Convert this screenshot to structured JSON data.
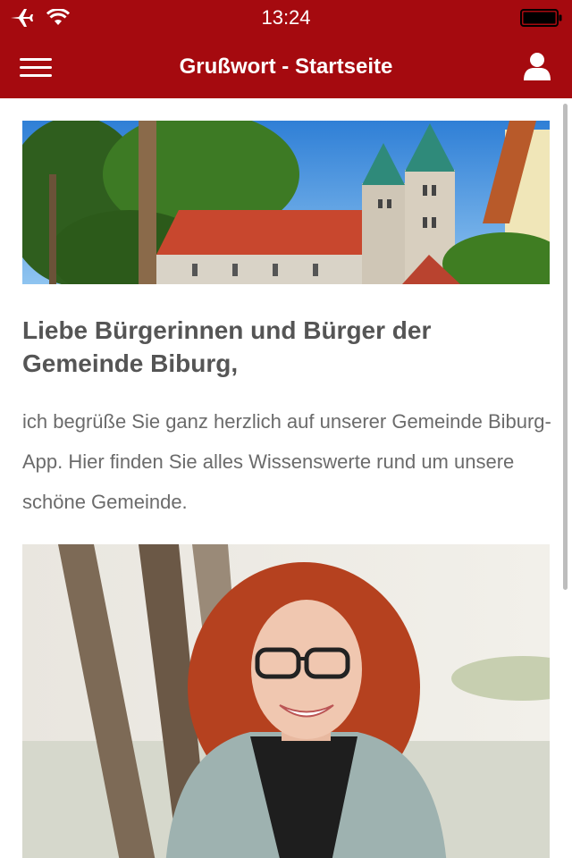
{
  "status_bar": {
    "time": "13:24",
    "icons": [
      "airplane-icon",
      "wifi-icon",
      "battery-icon"
    ]
  },
  "nav": {
    "title": "Grußwort - Startseite",
    "menu_icon": "hamburger-menu-icon",
    "user_icon": "user-icon"
  },
  "colors": {
    "brand": "#a50a0f",
    "heading_text": "#555555",
    "body_text": "#6b6b6b",
    "background": "#ffffff"
  },
  "content": {
    "heading": "Liebe Bürgerinnen und Bürger der Gemeinde Biburg,",
    "body": "ich begrüße Sie ganz herzlich auf unserer Gemeinde Biburg-App. Hier finden Sie alles Wissenswerte rund um unsere schöne Gemeinde."
  }
}
